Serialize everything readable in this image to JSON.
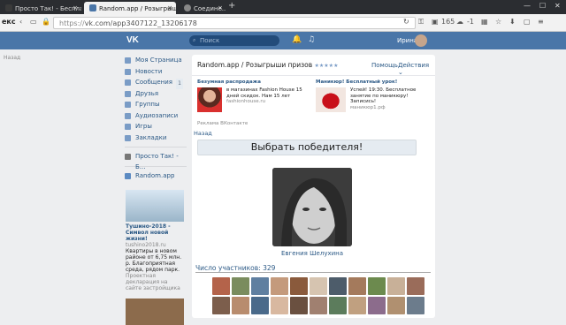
{
  "browser": {
    "tabs": [
      {
        "label": "Просто Так! - Бесплатно...",
        "active": false
      },
      {
        "label": "Random.app / Розыгрыш...",
        "active": true
      },
      {
        "label": "Соедине...",
        "active": false
      }
    ],
    "new_tab": "+",
    "left_frag": "екс",
    "url_prefix": "https://",
    "url_rest": "vk.com/app3407122_13206178",
    "ext_count": "165",
    "weather": "-1"
  },
  "vk": {
    "logo": "VK",
    "search_placeholder": "Поиск",
    "user_name": "Ирина",
    "back_left": "Назад",
    "nav": [
      {
        "label": "Моя Страница"
      },
      {
        "label": "Новости"
      },
      {
        "label": "Сообщения",
        "badge": "1"
      },
      {
        "label": "Друзья"
      },
      {
        "label": "Группы"
      },
      {
        "label": "Аудиозаписи"
      },
      {
        "label": "Игры"
      },
      {
        "label": "Закладки"
      }
    ],
    "nav2": [
      {
        "label": "Просто Так! - Б..."
      },
      {
        "label": "Random.app"
      }
    ],
    "side_ad": {
      "title": "Тушино-2018 - Символ новой жизни!",
      "source": "tushino2018.ru",
      "text": "Квартиры в новом районе от 6,75 млн. р. Благоприятная среда, рядом парк.",
      "note": "Проектная декларация на сайте застройщика"
    }
  },
  "app": {
    "title": "Random.app / Розыгрыши призов",
    "stars": "★★★★★",
    "help": "Помощь",
    "actions": "Действия",
    "ads": [
      {
        "title": "Безумная распродажа",
        "text": "в магазинах Fashion House 15 дней скидок. Нам 15 лет",
        "domain": "fashionhouse.ru"
      },
      {
        "title": "Маникюр! Бесплатный урок!",
        "text": "Успей! 19:30. Бесплатное занятие по маникюру! Записись!",
        "domain": "маникюр1.рф"
      }
    ],
    "vk_ads": "Реклама ВКонтакте",
    "back": "Назад",
    "choose_winner": "Выбрать победителя!",
    "winner_name": "Евгения Шелухина",
    "participants_label": "Число участников: 329"
  },
  "colors": {
    "vk_blue": "#4a76a8",
    "link": "#2a5885",
    "bg": "#edeef0"
  }
}
